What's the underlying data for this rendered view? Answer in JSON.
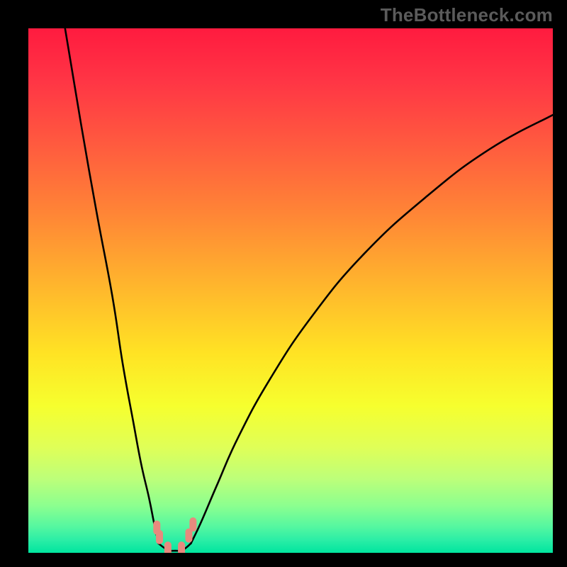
{
  "watermark": {
    "text": "TheBottleneck.com"
  },
  "colors": {
    "black": "#000000",
    "curve": "#000000",
    "marker": "#e78a7e",
    "gradient_stops": [
      {
        "offset": 0.0,
        "color": "#ff1b3f"
      },
      {
        "offset": 0.1,
        "color": "#ff3545"
      },
      {
        "offset": 0.22,
        "color": "#ff5a3f"
      },
      {
        "offset": 0.35,
        "color": "#ff8436"
      },
      {
        "offset": 0.5,
        "color": "#ffb92c"
      },
      {
        "offset": 0.62,
        "color": "#ffe324"
      },
      {
        "offset": 0.72,
        "color": "#f6ff2e"
      },
      {
        "offset": 0.8,
        "color": "#dfff58"
      },
      {
        "offset": 0.86,
        "color": "#bcff7a"
      },
      {
        "offset": 0.91,
        "color": "#8cff8f"
      },
      {
        "offset": 0.95,
        "color": "#55f7a0"
      },
      {
        "offset": 0.975,
        "color": "#2ceea6"
      },
      {
        "offset": 1.0,
        "color": "#00e59f"
      }
    ]
  },
  "chart_data": {
    "type": "line",
    "title": "",
    "xlabel": "",
    "ylabel": "",
    "xlim": [
      0,
      100
    ],
    "ylim": [
      0,
      100
    ],
    "grid": false,
    "series": [
      {
        "name": "left-branch",
        "x": [
          7.0,
          10.0,
          13.0,
          16.0,
          18.0,
          20.0,
          21.5,
          23.0,
          24.0,
          24.8
        ],
        "y": [
          100.0,
          82.0,
          65.0,
          49.0,
          36.0,
          25.0,
          17.0,
          10.5,
          5.5,
          1.8
        ]
      },
      {
        "name": "valley",
        "x": [
          24.8,
          26.5,
          28.0,
          29.5,
          31.0
        ],
        "y": [
          1.8,
          0.6,
          0.4,
          0.6,
          1.8
        ]
      },
      {
        "name": "right-branch",
        "x": [
          31.0,
          33.0,
          36.0,
          40.0,
          46.0,
          54.0,
          64.0,
          76.0,
          88.0,
          100.0
        ],
        "y": [
          1.8,
          6.0,
          13.0,
          22.0,
          33.0,
          45.0,
          57.0,
          68.0,
          77.0,
          83.5
        ]
      }
    ],
    "markers": [
      {
        "name": "left-cluster-top",
        "x": 24.5,
        "y": 4.8
      },
      {
        "name": "left-cluster-mid",
        "x": 25.0,
        "y": 3.0
      },
      {
        "name": "bottom-left",
        "x": 26.6,
        "y": 0.8
      },
      {
        "name": "bottom-right",
        "x": 29.2,
        "y": 0.8
      },
      {
        "name": "right-cluster-mid",
        "x": 30.6,
        "y": 3.3
      },
      {
        "name": "right-cluster-top",
        "x": 31.4,
        "y": 5.4
      }
    ]
  }
}
